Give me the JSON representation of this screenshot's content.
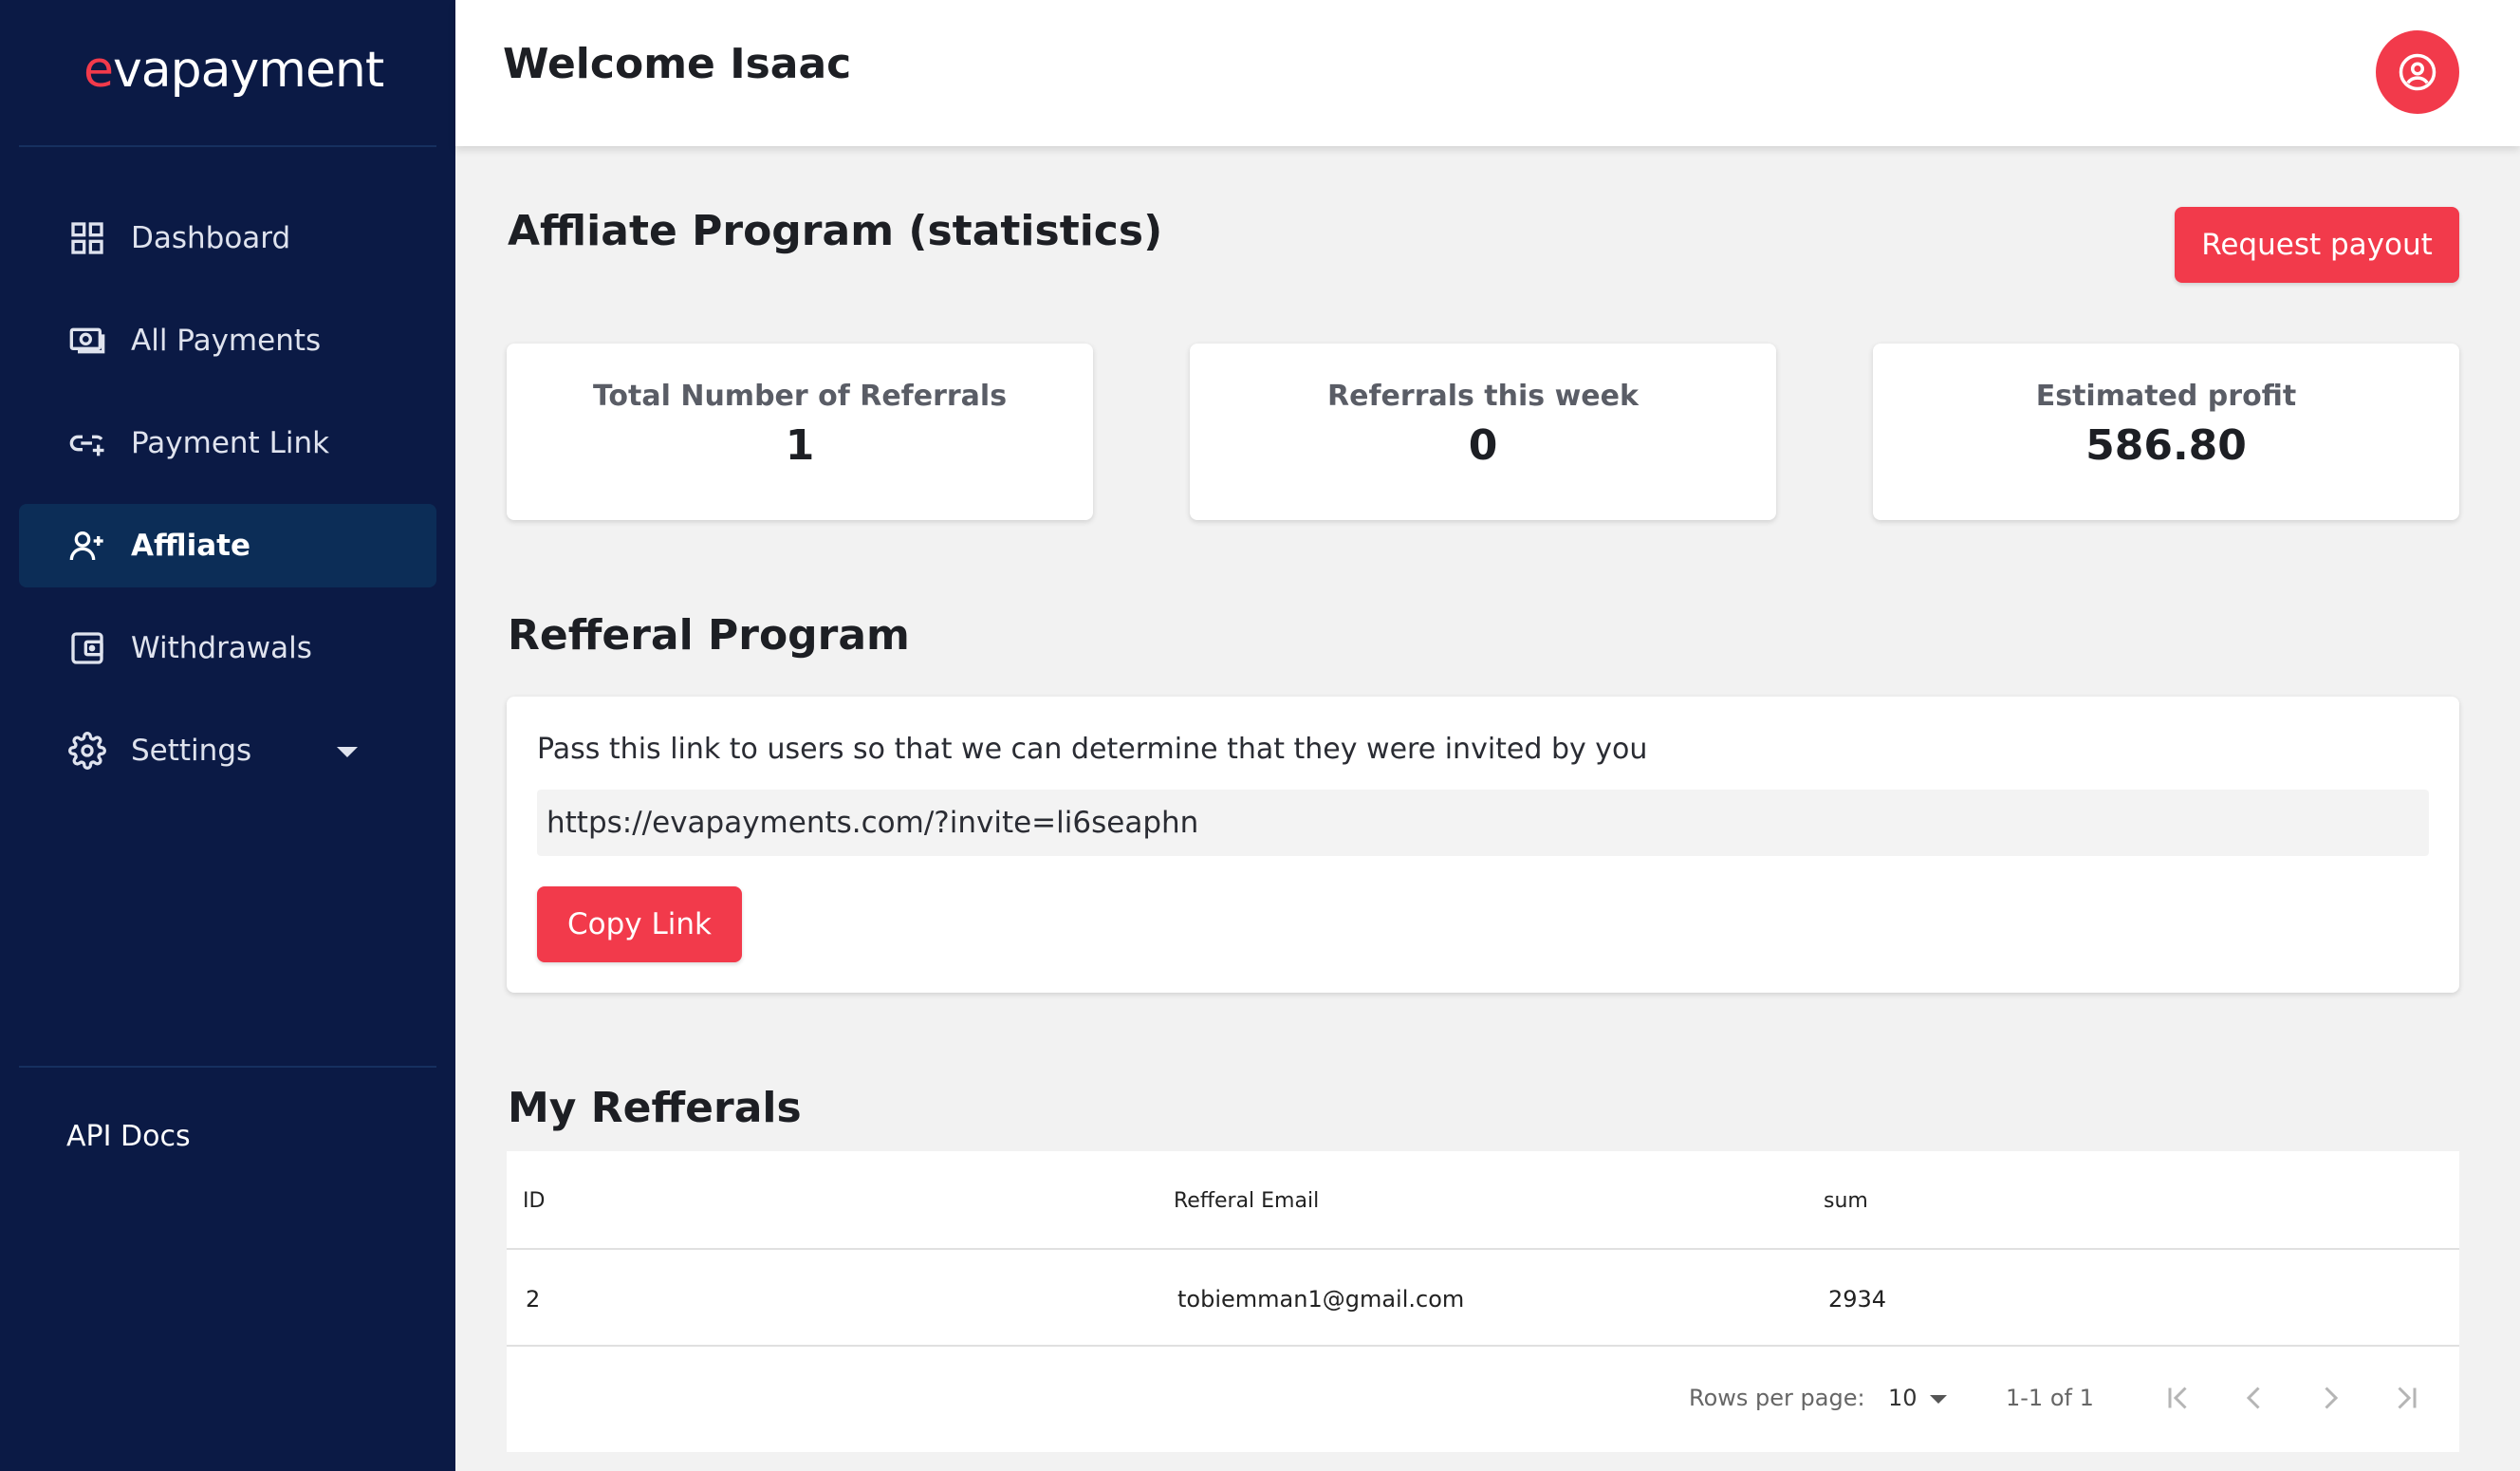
{
  "app": {
    "logo_prefix": "e",
    "logo_rest": "vapayment"
  },
  "colors": {
    "sidebar_bg": "#0b1a45",
    "sidebar_active": "#0c2d57",
    "accent_red": "#f23a4b",
    "page_bg": "#f2f2f2"
  },
  "sidebar": {
    "items": [
      {
        "label": "Dashboard",
        "icon": "grid-icon",
        "active": false
      },
      {
        "label": "All Payments",
        "icon": "money-icon",
        "active": false
      },
      {
        "label": "Payment Link",
        "icon": "link-icon",
        "active": false
      },
      {
        "label": "Affliate",
        "icon": "user-plus-icon",
        "active": true
      },
      {
        "label": "Withdrawals",
        "icon": "wallet-icon",
        "active": false
      },
      {
        "label": "Settings",
        "icon": "gear-icon",
        "active": false,
        "has_dropdown": true
      }
    ],
    "footer_link": "API Docs"
  },
  "header": {
    "welcome": "Welcome Isaac",
    "avatar_icon": "account-circle-icon"
  },
  "affiliate": {
    "title": "Affliate Program (statistics)",
    "request_payout": "Request payout",
    "stats": [
      {
        "label": "Total Number of Referrals",
        "value": "1"
      },
      {
        "label": "Referrals this week",
        "value": "0"
      },
      {
        "label": "Estimated profit",
        "value": "586.80"
      }
    ]
  },
  "referral_program": {
    "title": "Refferal Program",
    "description": "Pass this link to users so that we can determine that they were invited by you",
    "link": "https://evapayments.com/?invite=li6seaphn",
    "copy_button": "Copy Link"
  },
  "my_referrals": {
    "title": "My Refferals",
    "columns": [
      "ID",
      "Refferal Email",
      "sum"
    ],
    "rows": [
      {
        "id": "2",
        "email": "tobiemman1@gmail.com",
        "sum": "2934"
      }
    ],
    "pagination": {
      "rows_per_page_label": "Rows per page:",
      "rows_per_page": "10",
      "range": "1-1 of 1"
    }
  }
}
